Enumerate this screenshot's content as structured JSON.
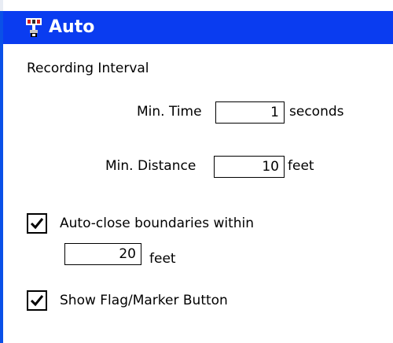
{
  "window": {
    "title": "Auto"
  },
  "recording_interval": {
    "heading": "Recording Interval",
    "min_time": {
      "label": "Min. Time",
      "value": "1",
      "unit": "seconds"
    },
    "min_distance": {
      "label": "Min. Distance",
      "value": "10",
      "unit": "feet"
    }
  },
  "auto_close": {
    "label": "Auto-close boundaries within",
    "checked": true,
    "value": "20",
    "unit": "feet"
  },
  "show_flag": {
    "label": "Show Flag/Marker Button",
    "checked": true
  },
  "icons": {
    "app": "gps-antenna-icon",
    "check": "checkmark-icon"
  },
  "colors": {
    "titlebar": "#0a3cf0",
    "title_text": "#ffffff"
  }
}
